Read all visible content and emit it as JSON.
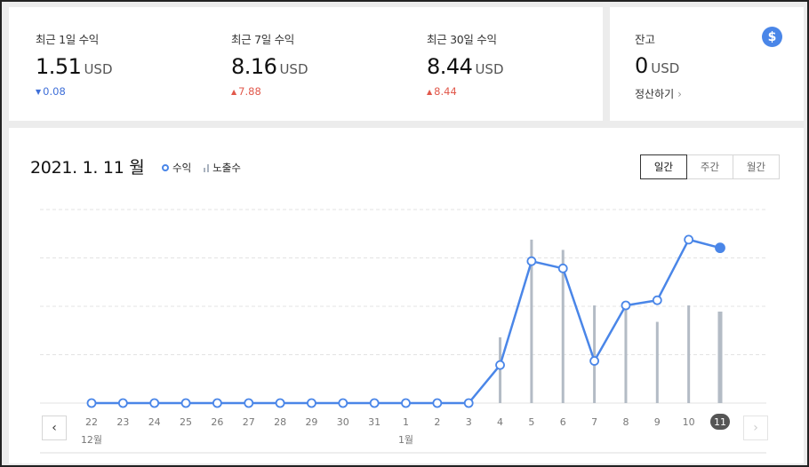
{
  "stats": [
    {
      "label": "최근 1일 수익",
      "value": "1.51",
      "unit": "USD",
      "change": "0.08",
      "direction": "down",
      "arrow": "▼"
    },
    {
      "label": "최근 7일 수익",
      "value": "8.16",
      "unit": "USD",
      "change": "7.88",
      "direction": "up",
      "arrow": "▲"
    },
    {
      "label": "최근 30일 수익",
      "value": "8.44",
      "unit": "USD",
      "change": "8.44",
      "direction": "up",
      "arrow": "▲"
    }
  ],
  "balance": {
    "label": "잔고",
    "value": "0",
    "unit": "USD",
    "settle_label": "정산하기",
    "settle_chevron": "›",
    "icon_glyph": "$",
    "icon": "dollar-icon"
  },
  "chart_header": {
    "date_title": "2021. 1. 11 월",
    "legend_revenue": "수익",
    "legend_impressions": "노출수",
    "tabs": [
      {
        "label": "일간",
        "active": true
      },
      {
        "label": "주간",
        "active": false
      },
      {
        "label": "월간",
        "active": false
      }
    ]
  },
  "nav": {
    "prev": "‹",
    "next": "›"
  },
  "colors": {
    "line": "#4a86e8",
    "bar": "#b3bbc5",
    "grid": "#e3e3e3",
    "down": "#3f6fd8",
    "up": "#e1584b"
  },
  "chart_data": {
    "type": "line",
    "x": [
      "22",
      "23",
      "24",
      "25",
      "26",
      "27",
      "28",
      "29",
      "30",
      "31",
      "1",
      "2",
      "3",
      "4",
      "5",
      "6",
      "7",
      "8",
      "9",
      "10",
      "11"
    ],
    "month_labels": [
      {
        "index": 0,
        "label": "12월"
      },
      {
        "index": 10,
        "label": "1월"
      }
    ],
    "selected_index": 20,
    "ylim": [
      0,
      1.9
    ],
    "grid": true,
    "series": [
      {
        "name": "수익",
        "type": "line",
        "values": [
          0,
          0,
          0,
          0,
          0,
          0,
          0,
          0,
          0,
          0,
          0,
          0,
          0,
          0.37,
          1.38,
          1.31,
          0.41,
          0.95,
          1.0,
          1.59,
          1.51
        ]
      },
      {
        "name": "노출수",
        "type": "bar",
        "values": [
          0,
          0,
          0,
          0,
          0,
          0,
          0,
          0,
          0,
          0,
          0,
          0,
          0,
          0.64,
          1.59,
          1.49,
          0.95,
          0.95,
          0.79,
          0.95,
          0.89
        ]
      }
    ]
  }
}
